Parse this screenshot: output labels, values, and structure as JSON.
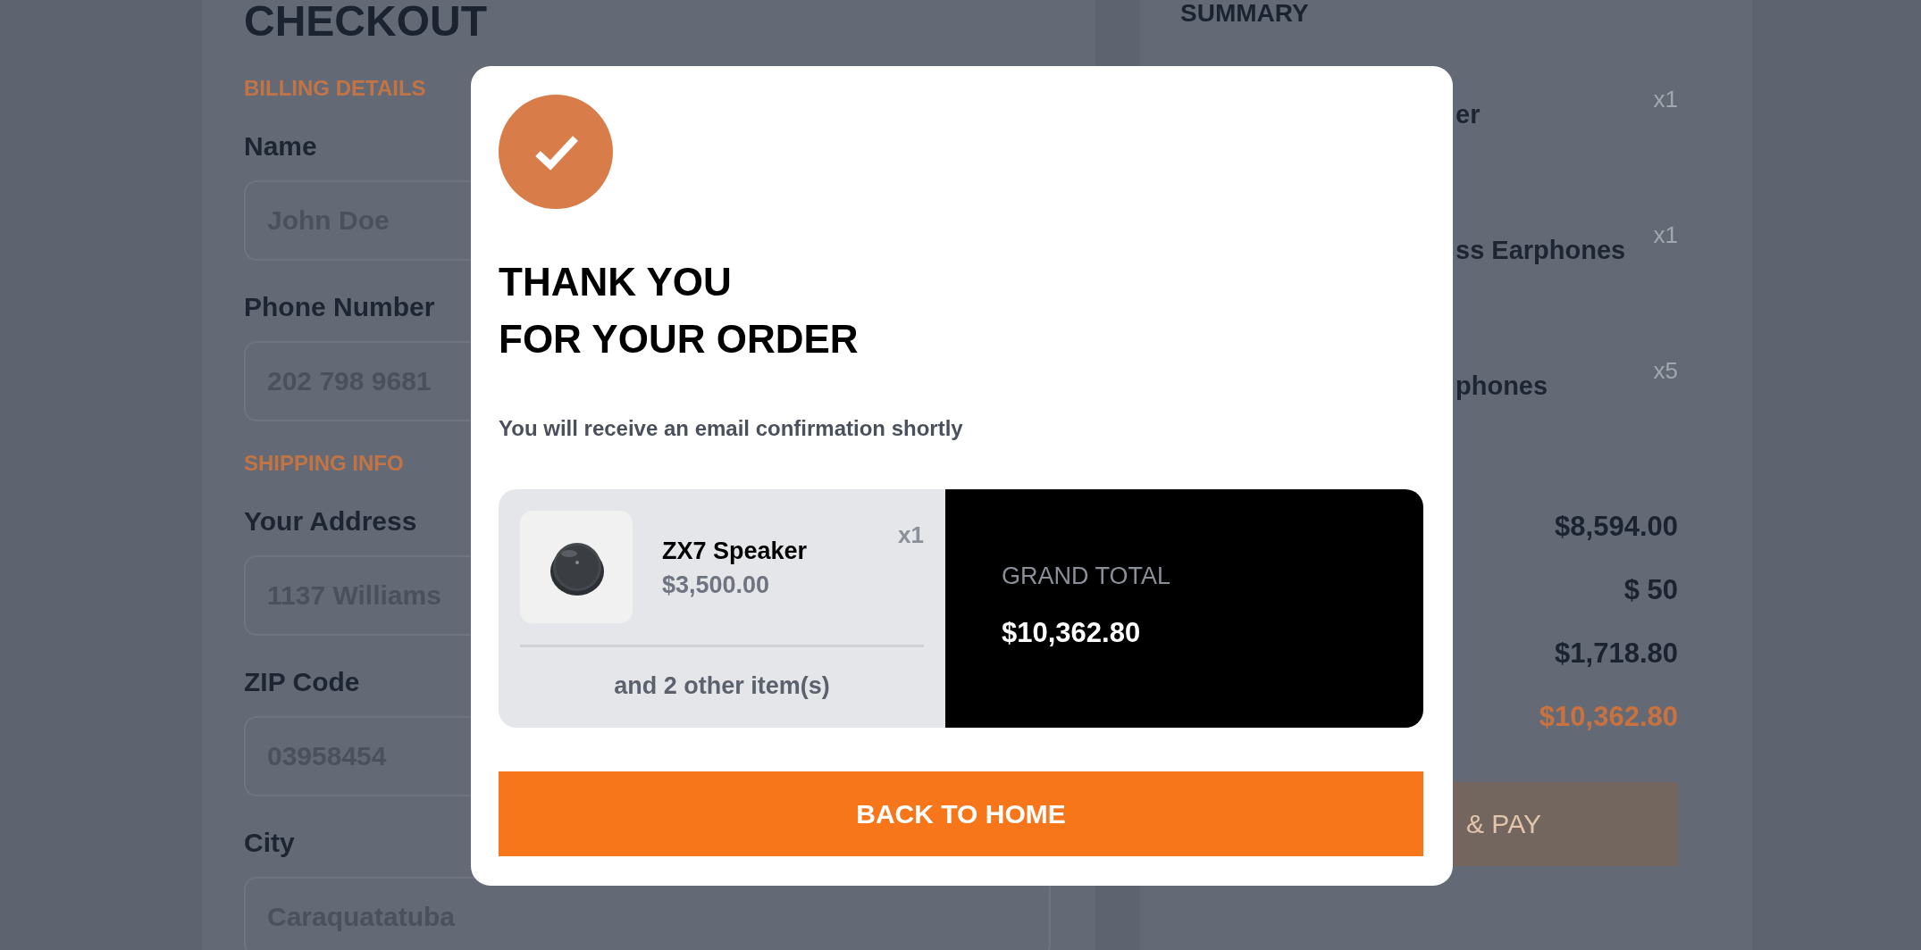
{
  "checkout": {
    "title": "CHECKOUT",
    "sections": [
      {
        "heading": "BILLING DETAILS",
        "fields": [
          {
            "label": "Name",
            "placeholder": "John Doe"
          },
          {
            "label": "Phone Number",
            "placeholder": "202 798 9681"
          }
        ]
      },
      {
        "heading": "SHIPPING INFO",
        "fields": [
          {
            "label": "Your Address",
            "placeholder": "1137 Williams"
          },
          {
            "label": "ZIP Code",
            "placeholder": "03958454"
          },
          {
            "label": "City",
            "placeholder": "Caraquatatuba"
          }
        ]
      }
    ]
  },
  "summary": {
    "title": "SUMMARY",
    "items": [
      {
        "name": "er",
        "qty": "x1"
      },
      {
        "name": "ss Earphones",
        "qty": "x1"
      },
      {
        "name": "phones",
        "qty": "x5"
      }
    ],
    "totals": [
      {
        "value": "$8,594.00",
        "kind": "plain"
      },
      {
        "value": "$ 50",
        "kind": "plain"
      },
      {
        "value": "$1,718.80",
        "kind": "plain"
      },
      {
        "value": "$10,362.80",
        "kind": "grand"
      }
    ],
    "pay_button": "& PAY"
  },
  "modal": {
    "title_lines": [
      "THANK YOU",
      "FOR YOUR ORDER"
    ],
    "message": "You will receive an email confirmation shortly",
    "item": {
      "name": "ZX7 Speaker",
      "price": "$3,500.00",
      "qty": "x1"
    },
    "others": "and 2 other item(s)",
    "grand_total_label": "GRAND TOTAL",
    "grand_total": "$10,362.80",
    "button": "BACK TO HOME"
  }
}
